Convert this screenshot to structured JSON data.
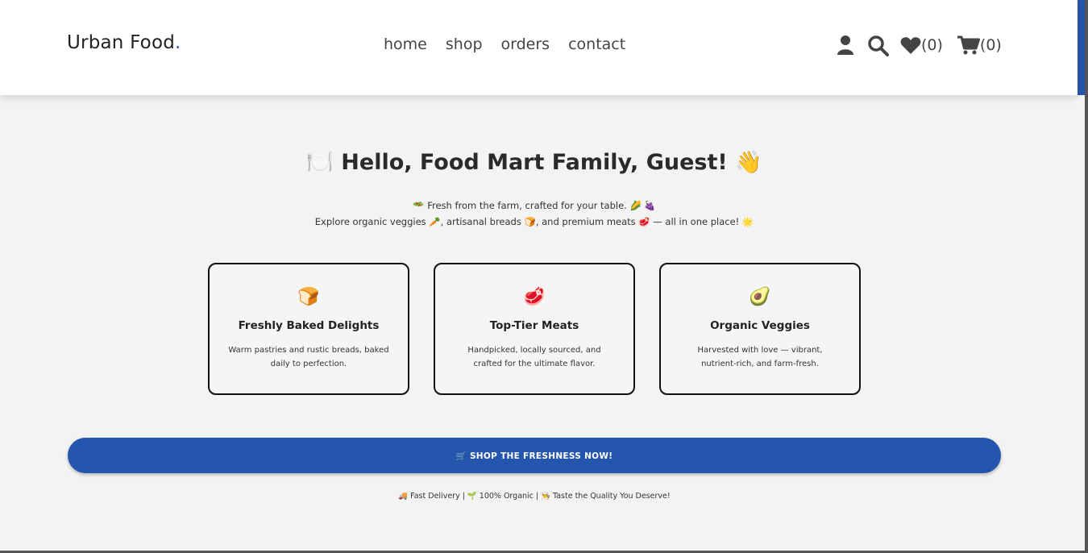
{
  "header": {
    "logo_text": "Urban Food",
    "logo_dot": ".",
    "nav": [
      {
        "label": "home"
      },
      {
        "label": "shop"
      },
      {
        "label": "orders"
      },
      {
        "label": "contact"
      }
    ],
    "icons": {
      "user": "user-icon",
      "search": "search-icon",
      "heart": "heart-icon",
      "cart": "cart-icon"
    },
    "wishlist_count": "(0)",
    "cart_count": "(0)"
  },
  "hero": {
    "title": "🍽️ Hello, Food Mart Family, Guest! 👋",
    "line1": "🥗 Fresh from the farm, crafted for your table. 🌽 🍇",
    "line2": "Explore organic veggies 🥕, artisanal breads 🍞, and premium meats 🥩 — all in one place! 🌟"
  },
  "cards": [
    {
      "icon": "🍞",
      "title": "Freshly Baked Delights",
      "desc": "Warm pastries and rustic breads, baked daily to perfection."
    },
    {
      "icon": "🥩",
      "title": "Top-Tier Meats",
      "desc": "Handpicked, locally sourced, and crafted for the ultimate flavor."
    },
    {
      "icon": "🥑",
      "title": "Organic Veggies",
      "desc": "Harvested with love — vibrant, nutrient-rich, and farm-fresh."
    }
  ],
  "cta": {
    "label": "🛒 SHOP THE FRESHNESS NOW!"
  },
  "footer_note": "🚚 Fast Delivery | 🌱 100% Organic | 👨‍🍳 Taste the Quality You Deserve!",
  "colors": {
    "accent": "#2456ad",
    "background": "#f3f3f3",
    "header_bg": "#ffffff"
  }
}
